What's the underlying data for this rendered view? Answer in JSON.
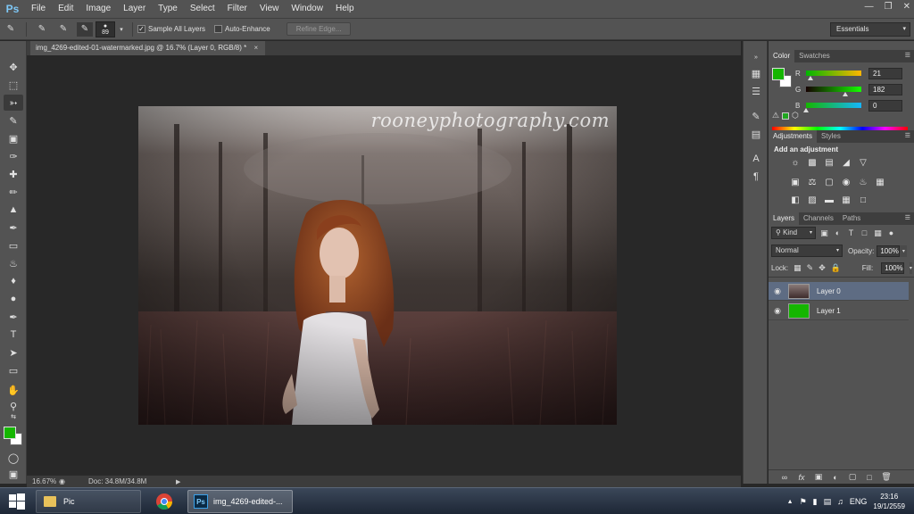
{
  "app": {
    "logo": "Ps",
    "menu": [
      "File",
      "Edit",
      "Image",
      "Layer",
      "Type",
      "Select",
      "Filter",
      "View",
      "Window",
      "Help"
    ],
    "window_controls": [
      "minimize",
      "restore",
      "close"
    ]
  },
  "options_bar": {
    "brush_size": "89",
    "sample_all_layers_label": "Sample All Layers",
    "sample_all_layers_checked": true,
    "auto_enhance_label": "Auto-Enhance",
    "auto_enhance_checked": false,
    "refine_edge_label": "Refine Edge...",
    "workspace": "Essentials"
  },
  "document": {
    "tab_title": "img_4269-edited-01-watermarked.jpg @ 16.7% (Layer 0, RGB/8) *",
    "watermark": "rooneyphotography.com"
  },
  "status_bar": {
    "zoom": "16.67%",
    "doc_size": "Doc: 34.8M/34.8M"
  },
  "color_panel": {
    "tabs": [
      "Color",
      "Swatches"
    ],
    "r_label": "R",
    "g_label": "G",
    "b_label": "B",
    "r_value": "21",
    "g_value": "182",
    "b_value": "0",
    "r_level": 0.08,
    "g_level": 0.71,
    "b_level": 0.0,
    "foreground": "#15b600",
    "background": "#ffffff"
  },
  "adjustments_panel": {
    "tabs": [
      "Adjustments",
      "Styles"
    ],
    "title": "Add an adjustment"
  },
  "layers_panel": {
    "tabs": [
      "Layers",
      "Channels",
      "Paths"
    ],
    "kind_label": "Kind",
    "blend_mode": "Normal",
    "opacity_label": "Opacity:",
    "opacity_value": "100%",
    "lock_label": "Lock:",
    "fill_label": "Fill:",
    "fill_value": "100%",
    "layers": [
      {
        "name": "Layer 0",
        "selected": true
      },
      {
        "name": "Layer 1",
        "selected": false
      }
    ]
  },
  "taskbar": {
    "items": [
      "Pic",
      "img_4269-edited-..."
    ],
    "language": "ENG",
    "time": "23:16",
    "date": "19/1/2559"
  }
}
